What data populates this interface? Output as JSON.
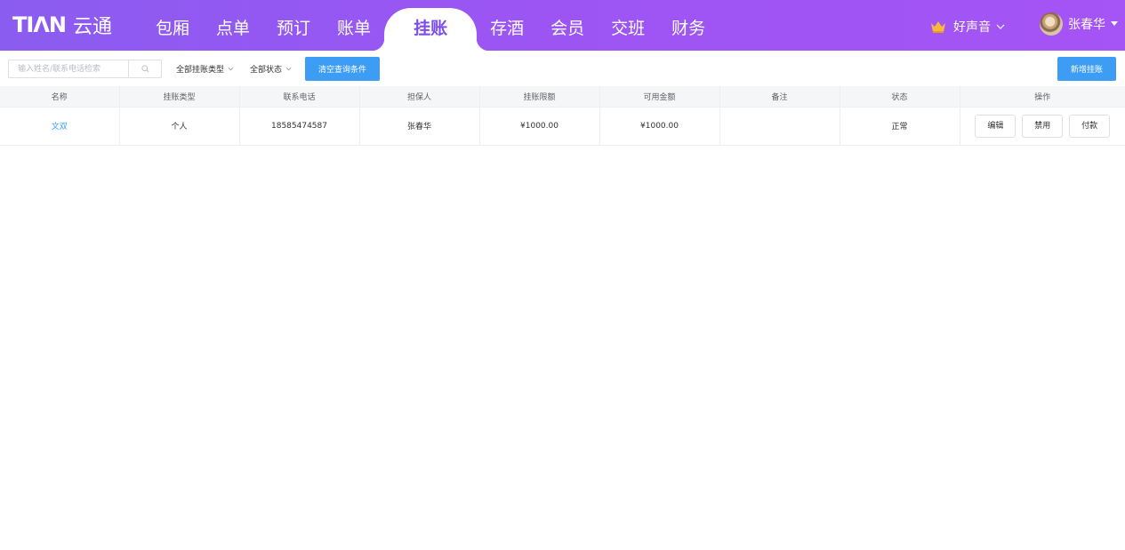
{
  "app": {
    "logo_mark_a": "TI",
    "logo_mark_b": "ΛN",
    "logo_text": "云通"
  },
  "nav": {
    "items": [
      {
        "label": "包厢",
        "active": false
      },
      {
        "label": "点单",
        "active": false
      },
      {
        "label": "预订",
        "active": false
      },
      {
        "label": "账单",
        "active": false
      },
      {
        "label": "挂账",
        "active": true
      },
      {
        "label": "存酒",
        "active": false
      },
      {
        "label": "会员",
        "active": false
      },
      {
        "label": "交班",
        "active": false
      },
      {
        "label": "财务",
        "active": false
      }
    ]
  },
  "store": {
    "name": "好声音",
    "icon": "crown-icon"
  },
  "user": {
    "name": "张春华",
    "icon": "avatar"
  },
  "toolbar": {
    "search_placeholder": "输入姓名/联系电话检索",
    "filter_type_label": "全部挂账类型",
    "filter_status_label": "全部状态",
    "clear_label": "清空查询条件",
    "add_label": "新增挂账"
  },
  "table": {
    "headers": [
      "名称",
      "挂账类型",
      "联系电话",
      "担保人",
      "挂账限额",
      "可用金额",
      "备注",
      "状态",
      "操作"
    ],
    "rows": [
      {
        "name": "文双",
        "type": "个人",
        "phone": "18585474587",
        "guarantor": "张春华",
        "limit": "¥1000.00",
        "available": "¥1000.00",
        "note": "",
        "status": "正常",
        "actions": [
          "编辑",
          "禁用",
          "付款"
        ]
      }
    ]
  },
  "colors": {
    "header_gradient_start": "#8b5cf0",
    "header_gradient_end": "#a554f5",
    "primary": "#3d9df5",
    "active_tab_text": "#7c4dea"
  }
}
